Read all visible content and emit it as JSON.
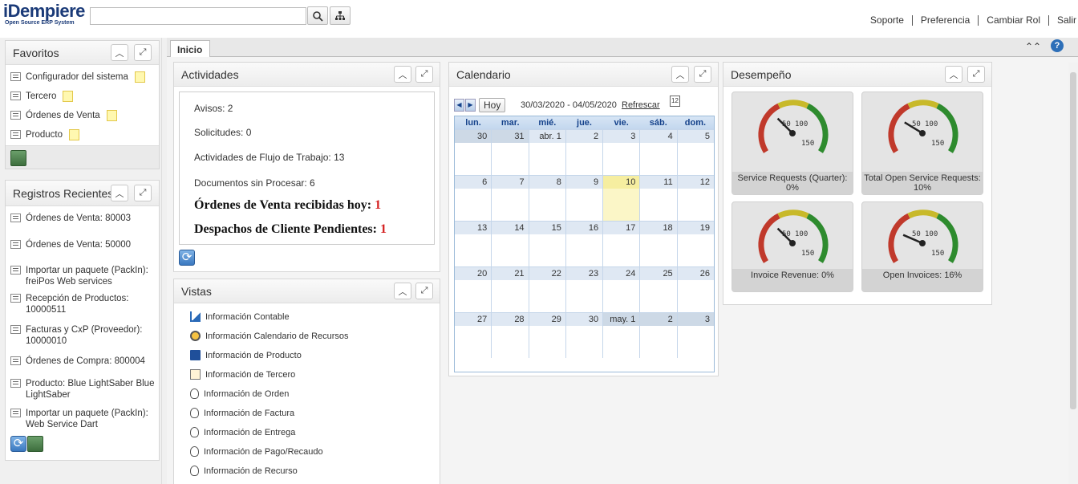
{
  "app": {
    "logo_name": "iDempiere",
    "logo_tagline": "Open Source ERP System"
  },
  "header": {
    "search_placeholder": "",
    "links": [
      "Soporte",
      "Preferencia",
      "Cambiar Rol",
      "Salir"
    ]
  },
  "favorites": {
    "title": "Favoritos",
    "items": [
      {
        "label": "Configurador del sistema"
      },
      {
        "label": "Tercero"
      },
      {
        "label": "Órdenes de Venta"
      },
      {
        "label": "Producto"
      }
    ]
  },
  "recent": {
    "title": "Registros Recientes",
    "items": [
      "Órdenes de Venta: 80003",
      "Órdenes de Venta: 50000",
      "Importar un paquete (PackIn): freiPos Web services",
      "Recepción de Productos: 10000511",
      "Facturas y CxP (Proveedor): 10000010",
      "Órdenes de Compra: 800004",
      "Producto: Blue LightSaber Blue LightSaber",
      "Importar un paquete (PackIn): Web Service Dart"
    ]
  },
  "tabs": [
    {
      "label": "Inicio"
    }
  ],
  "activities": {
    "title": "Actividades",
    "avisos": "Avisos: 2",
    "solicitudes": "Solicitudes: 0",
    "flujo": "Actividades de Flujo de Trabajo: 13",
    "documentos": "Documentos sin Procesar: 6",
    "ordenes_label": "Órdenes de Venta recibidas hoy: ",
    "ordenes_value": "1",
    "despachos_label": "Despachos de Cliente Pendientes: ",
    "despachos_value": "1"
  },
  "views": {
    "title": "Vistas",
    "items": [
      "Información Contable",
      "Información Calendario de Recursos",
      "Información de Producto",
      "Información de Tercero",
      "Información de Orden",
      "Información de Factura",
      "Información de Entrega",
      "Información de Pago/Recaudo",
      "Información de Recurso"
    ]
  },
  "calendar": {
    "title": "Calendario",
    "today_button": "Hoy",
    "range": "30/03/2020 - 04/05/2020",
    "refresh_link": "Refrescar",
    "weekdays": [
      "lun.",
      "mar.",
      "mié.",
      "jue.",
      "vie.",
      "sáb.",
      "dom."
    ],
    "weeks": [
      [
        "30",
        "31",
        "abr. 1",
        "2",
        "3",
        "4",
        "5"
      ],
      [
        "6",
        "7",
        "8",
        "9",
        "10",
        "11",
        "12"
      ],
      [
        "13",
        "14",
        "15",
        "16",
        "17",
        "18",
        "19"
      ],
      [
        "20",
        "21",
        "22",
        "23",
        "24",
        "25",
        "26"
      ],
      [
        "27",
        "28",
        "29",
        "30",
        "may. 1",
        "2",
        "3"
      ]
    ],
    "today": "10"
  },
  "performance": {
    "title": "Desempeño",
    "gauges": [
      {
        "label": "Service Requests (Quarter): 0%",
        "value": 0
      },
      {
        "label": "Total Open Service Requests: 10%",
        "value": 10
      },
      {
        "label": "Invoice Revenue: 0%",
        "value": 0
      },
      {
        "label": "Open Invoices: 16%",
        "value": 16
      }
    ],
    "scale_labels": [
      "50",
      "100",
      "150"
    ]
  },
  "colors": {
    "accent": "#1a3a78",
    "alert_number": "#d42020",
    "calendar_header": "#15428b",
    "today_highlight": "#fbf6c7"
  }
}
